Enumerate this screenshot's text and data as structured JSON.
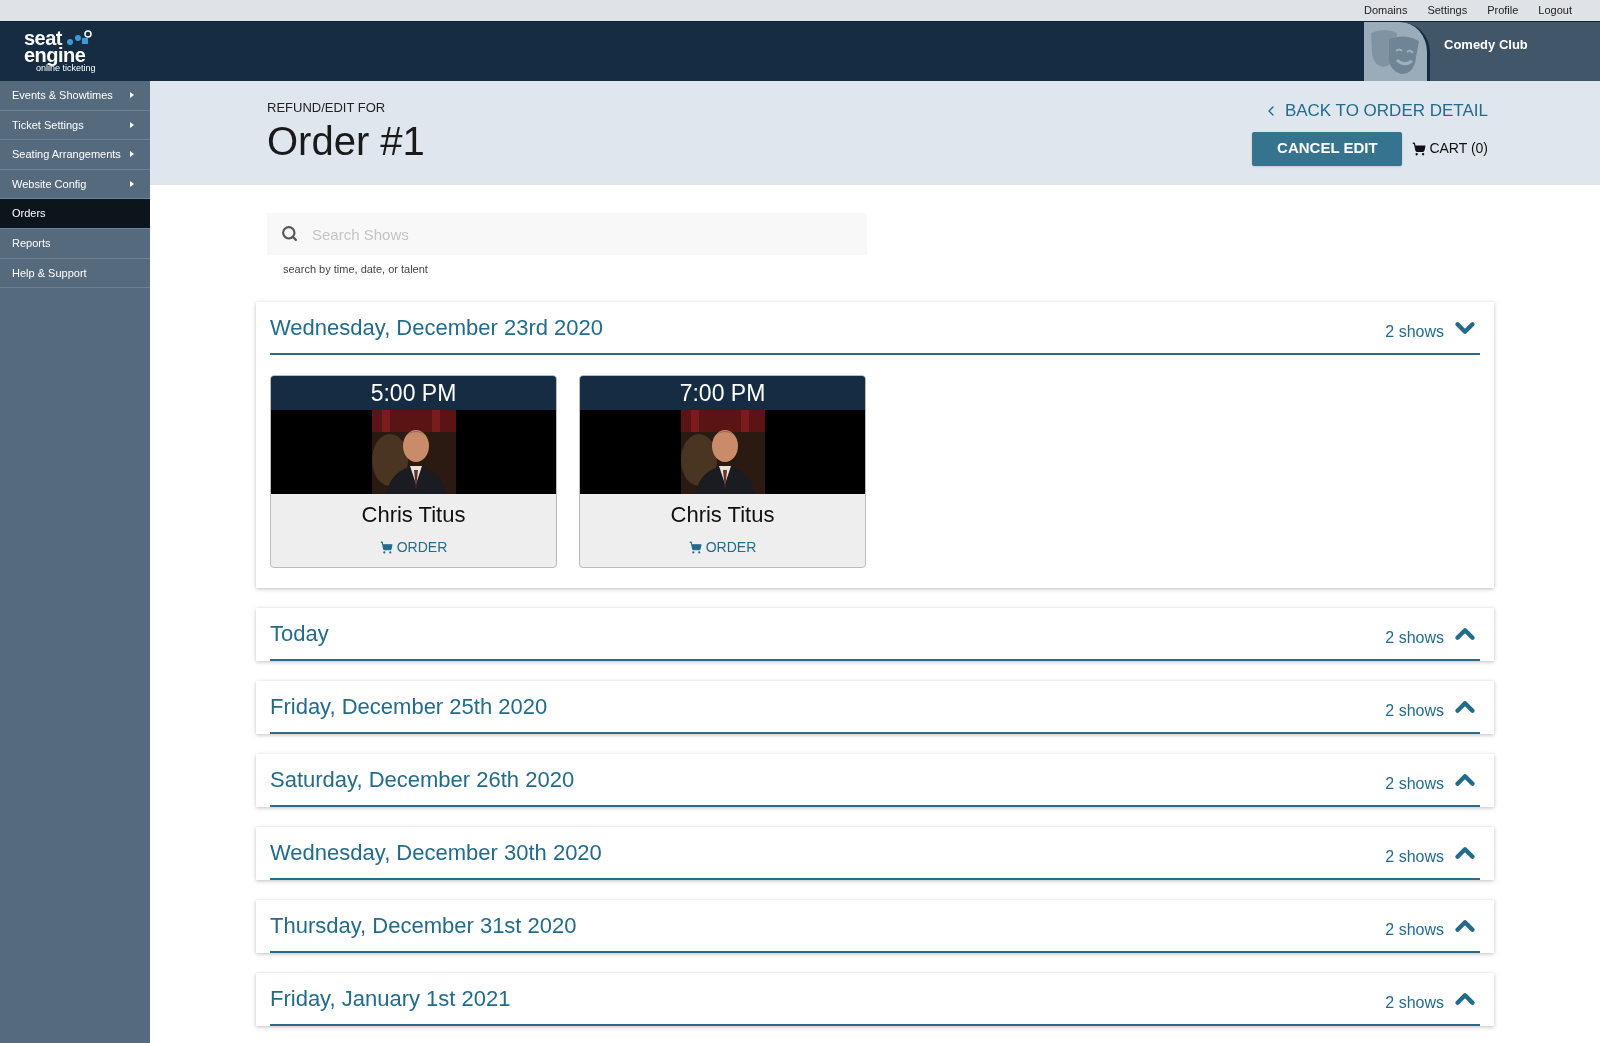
{
  "top_links": [
    "Domains",
    "Settings",
    "Profile",
    "Logout"
  ],
  "logo": {
    "line1": "seat",
    "line2": "engine",
    "tagline": "online ticketing"
  },
  "venue": {
    "name": "Comedy Club"
  },
  "sidebar": {
    "items": [
      {
        "label": "Events & Showtimes",
        "submenu": true,
        "selected": false
      },
      {
        "label": "Ticket Settings",
        "submenu": true,
        "selected": false
      },
      {
        "label": "Seating Arrangements",
        "submenu": true,
        "selected": false
      },
      {
        "label": "Website Config",
        "submenu": true,
        "selected": false
      },
      {
        "label": "Orders",
        "submenu": false,
        "selected": true
      },
      {
        "label": "Reports",
        "submenu": false,
        "selected": false
      },
      {
        "label": "Help & Support",
        "submenu": false,
        "selected": false
      }
    ]
  },
  "header": {
    "overline": "REFUND/EDIT FOR",
    "title": "Order #1",
    "back_link": "BACK TO ORDER DETAIL",
    "cancel_button": "CANCEL EDIT",
    "cart": "CART (0)"
  },
  "search": {
    "placeholder": "Search Shows",
    "hint": "search by time, date, or talent"
  },
  "days": [
    {
      "title": "Wednesday, December 23rd 2020",
      "count": "2 shows",
      "expanded": true,
      "shows": [
        {
          "time": "5:00 PM",
          "name": "Chris Titus",
          "action": "ORDER"
        },
        {
          "time": "7:00 PM",
          "name": "Chris Titus",
          "action": "ORDER"
        }
      ]
    },
    {
      "title": "Today",
      "count": "2 shows",
      "expanded": false
    },
    {
      "title": "Friday, December 25th 2020",
      "count": "2 shows",
      "expanded": false
    },
    {
      "title": "Saturday, December 26th 2020",
      "count": "2 shows",
      "expanded": false
    },
    {
      "title": "Wednesday, December 30th 2020",
      "count": "2 shows",
      "expanded": false
    },
    {
      "title": "Thursday, December 31st 2020",
      "count": "2 shows",
      "expanded": false
    },
    {
      "title": "Friday, January 1st 2021",
      "count": "2 shows",
      "expanded": false
    }
  ]
}
